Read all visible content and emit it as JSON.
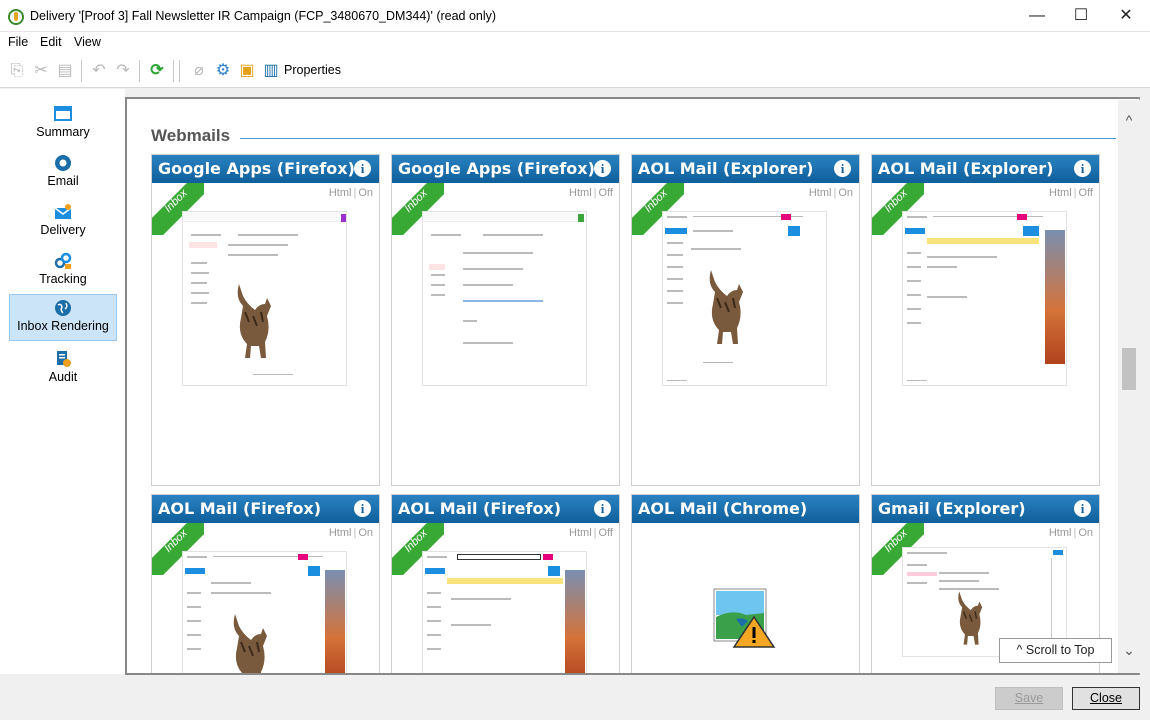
{
  "window": {
    "title": "Delivery '[Proof 3] Fall Newsletter IR Campaign (FCP_3480670_DM344)' (read only)",
    "minimize": "—",
    "maximize": "☐",
    "close": "✕"
  },
  "menu": [
    "File",
    "Edit",
    "View"
  ],
  "toolbar": {
    "properties_label": "Properties"
  },
  "sidebar": {
    "items": [
      {
        "label": "Summary",
        "icon": "summary-icon"
      },
      {
        "label": "Email",
        "icon": "email-icon"
      },
      {
        "label": "Delivery",
        "icon": "delivery-icon"
      },
      {
        "label": "Tracking",
        "icon": "tracking-icon"
      },
      {
        "label": "Inbox Rendering",
        "icon": "globe-icon",
        "active": true
      },
      {
        "label": "Audit",
        "icon": "audit-icon"
      }
    ]
  },
  "section": {
    "title": "Webmails"
  },
  "cards": [
    {
      "title": "Google Apps (Firefox)",
      "html_label": "Html",
      "mode": "On",
      "ribbon": "Inbox"
    },
    {
      "title": "Google Apps (Firefox)",
      "html_label": "Html",
      "mode": "Off",
      "ribbon": "Inbox"
    },
    {
      "title": "AOL Mail (Explorer)",
      "html_label": "Html",
      "mode": "On",
      "ribbon": "Inbox"
    },
    {
      "title": "AOL Mail (Explorer)",
      "html_label": "Html",
      "mode": "Off",
      "ribbon": "Inbox"
    },
    {
      "title": "AOL Mail (Firefox)",
      "html_label": "Html",
      "mode": "On",
      "ribbon": "Inbox"
    },
    {
      "title": "AOL Mail (Firefox)",
      "html_label": "Html",
      "mode": "Off",
      "ribbon": "Inbox"
    },
    {
      "title": "AOL Mail (Chrome)"
    },
    {
      "title": "Gmail (Explorer)",
      "html_label": "Html",
      "mode": "On",
      "ribbon": "Inbox"
    }
  ],
  "info_glyph": "i",
  "separator": "|",
  "scroll_top_label": "^ Scroll to Top",
  "buttons": {
    "save": "Save",
    "close": "Close"
  },
  "colors": {
    "accent": "#1b6ea8",
    "ribbon": "#39a935",
    "active_nav": "#cce4f7"
  }
}
